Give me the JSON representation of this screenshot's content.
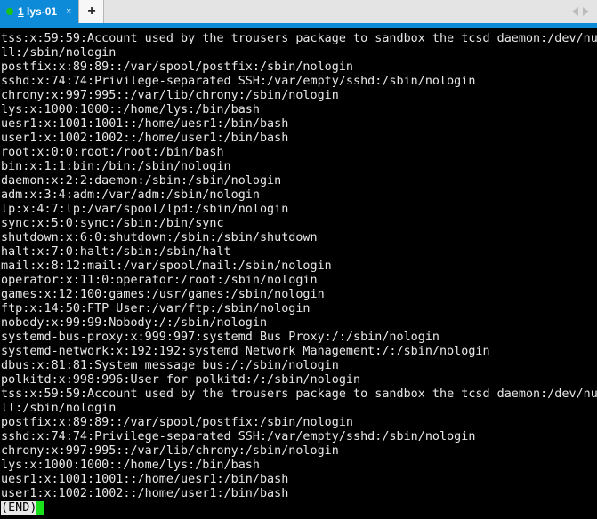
{
  "window": {
    "app": "terminal-emulator",
    "accent_blue": "#0d8bd9",
    "tabbar_bg": "#e4e4e4",
    "terminal_bg": "#000000",
    "terminal_fg": "#e8e8e8",
    "cursor_color": "#19e019",
    "status_dot_color": "#19c219"
  },
  "tabbar": {
    "tabs": [
      {
        "index_label": "1",
        "title": " lys-01",
        "close_label": "×",
        "active": true,
        "status_dot": "connected-dot"
      }
    ],
    "new_tab_label": "+",
    "nav_prev_label": "previous-tab",
    "nav_next_label": "next-tab"
  },
  "terminal": {
    "pager": "less",
    "status_line": "(END)",
    "lines": [
      "tss:x:59:59:Account used by the trousers package to sandbox the tcsd daemon:/dev/nu",
      "ll:/sbin/nologin",
      "postfix:x:89:89::/var/spool/postfix:/sbin/nologin",
      "sshd:x:74:74:Privilege-separated SSH:/var/empty/sshd:/sbin/nologin",
      "chrony:x:997:995::/var/lib/chrony:/sbin/nologin",
      "lys:x:1000:1000::/home/lys:/bin/bash",
      "uesr1:x:1001:1001::/home/uesr1:/bin/bash",
      "user1:x:1002:1002::/home/user1:/bin/bash",
      "root:x:0:0:root:/root:/bin/bash",
      "bin:x:1:1:bin:/bin:/sbin/nologin",
      "daemon:x:2:2:daemon:/sbin:/sbin/nologin",
      "adm:x:3:4:adm:/var/adm:/sbin/nologin",
      "lp:x:4:7:lp:/var/spool/lpd:/sbin/nologin",
      "sync:x:5:0:sync:/sbin:/bin/sync",
      "shutdown:x:6:0:shutdown:/sbin:/sbin/shutdown",
      "halt:x:7:0:halt:/sbin:/sbin/halt",
      "mail:x:8:12:mail:/var/spool/mail:/sbin/nologin",
      "operator:x:11:0:operator:/root:/sbin/nologin",
      "games:x:12:100:games:/usr/games:/sbin/nologin",
      "ftp:x:14:50:FTP User:/var/ftp:/sbin/nologin",
      "nobody:x:99:99:Nobody:/:/sbin/nologin",
      "systemd-bus-proxy:x:999:997:systemd Bus Proxy:/:/sbin/nologin",
      "systemd-network:x:192:192:systemd Network Management:/:/sbin/nologin",
      "dbus:x:81:81:System message bus:/:/sbin/nologin",
      "polkitd:x:998:996:User for polkitd:/:/sbin/nologin",
      "tss:x:59:59:Account used by the trousers package to sandbox the tcsd daemon:/dev/nu",
      "ll:/sbin/nologin",
      "postfix:x:89:89::/var/spool/postfix:/sbin/nologin",
      "sshd:x:74:74:Privilege-separated SSH:/var/empty/sshd:/sbin/nologin",
      "chrony:x:997:995::/var/lib/chrony:/sbin/nologin",
      "lys:x:1000:1000::/home/lys:/bin/bash",
      "uesr1:x:1001:1001::/home/uesr1:/bin/bash",
      "user1:x:1002:1002::/home/user1:/bin/bash"
    ]
  }
}
